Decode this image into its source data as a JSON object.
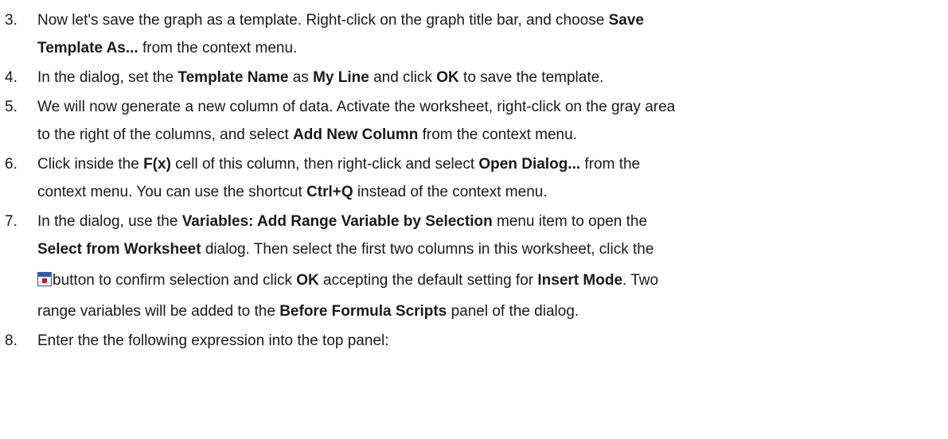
{
  "steps": [
    {
      "num": "3.",
      "lines": [
        [
          "Now let's save the graph as a template. Right-click on the graph title bar, and choose ",
          {
            "b": "Save"
          }
        ],
        [
          {
            "b": "Template As..."
          },
          " from the context menu."
        ]
      ]
    },
    {
      "num": "4.",
      "lines": [
        [
          "In the dialog, set the ",
          {
            "b": "Template Name"
          },
          " as ",
          {
            "b": "My Line"
          },
          " and click ",
          {
            "b": "OK"
          },
          " to save the template."
        ]
      ]
    },
    {
      "num": "5.",
      "lines": [
        [
          "We will now generate a new column of data. Activate the worksheet, right-click on the gray area"
        ],
        [
          "to the right of the columns, and select ",
          {
            "b": "Add New Column"
          },
          " from the context menu."
        ]
      ]
    },
    {
      "num": "6.",
      "lines": [
        [
          "Click inside the ",
          {
            "b": "F(x)"
          },
          " cell of this column, then right-click and select ",
          {
            "b": "Open Dialog..."
          },
          " from the"
        ],
        [
          "context menu. You can use the shortcut ",
          {
            "b": "Ctrl+Q"
          },
          " instead of the context menu."
        ]
      ]
    },
    {
      "num": "7.",
      "lines": [
        [
          "In the dialog, use the ",
          {
            "b": "Variables: Add Range Variable by Selection"
          },
          " menu item to open the"
        ],
        [
          {
            "b": "Select from Worksheet"
          },
          " dialog. Then select the first two columns in this worksheet, click the"
        ],
        [
          {
            "icon": "select-confirm-icon"
          },
          "button to confirm selection and click ",
          {
            "b": "OK"
          },
          " accepting the default setting for ",
          {
            "b": "Insert Mode"
          },
          ". Two"
        ],
        [
          "range variables will be added to the ",
          {
            "b": "Before Formula Scripts"
          },
          " panel of the dialog."
        ]
      ]
    },
    {
      "num": "8.",
      "lines": [
        [
          "Enter the the following expression into the top panel:"
        ]
      ]
    }
  ]
}
